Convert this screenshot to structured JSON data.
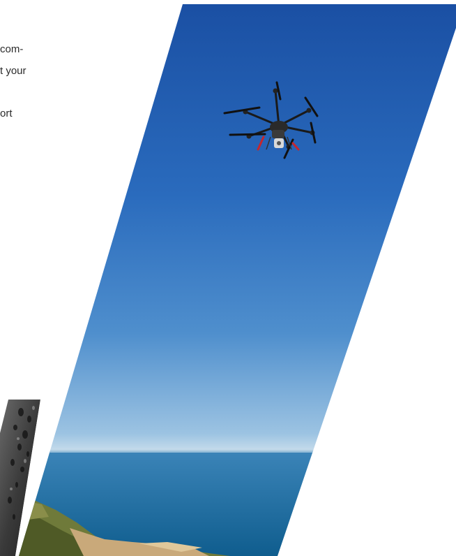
{
  "body_text": {
    "line1": "com-",
    "line2": "t your",
    "line3": "ort"
  },
  "images": {
    "main": {
      "subject": "hexacopter-drone-over-coastline",
      "sky_top": "#1d55a8",
      "sky_bottom": "#cfe0ec",
      "sea": "#1e6fa0"
    },
    "secondary": {
      "subject": "grayscale-porous-texture"
    }
  }
}
